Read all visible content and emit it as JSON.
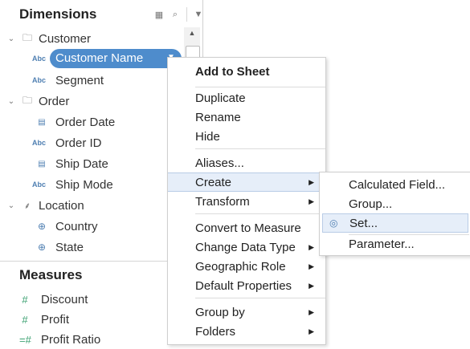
{
  "dimensions": {
    "title": "Dimensions",
    "header_icons": [
      "grid-icon",
      "search-icon",
      "dropdown-icon"
    ],
    "tree": [
      {
        "label": "Customer",
        "type": "folder"
      },
      {
        "label": "Customer Name",
        "type": "abc",
        "selected": true
      },
      {
        "label": "Segment",
        "type": "abc"
      },
      {
        "label": "Order",
        "type": "folder"
      },
      {
        "label": "Order Date",
        "type": "date"
      },
      {
        "label": "Order ID",
        "type": "abc"
      },
      {
        "label": "Ship Date",
        "type": "date"
      },
      {
        "label": "Ship Mode",
        "type": "abc"
      },
      {
        "label": "Location",
        "type": "hierarchy"
      },
      {
        "label": "Country",
        "type": "geo"
      },
      {
        "label": "State",
        "type": "geo"
      }
    ],
    "abc_badge": "Abc"
  },
  "measures": {
    "title": "Measures",
    "items": [
      {
        "label": "Discount"
      },
      {
        "label": "Profit"
      },
      {
        "label": "Profit Ratio"
      }
    ]
  },
  "context_menu": {
    "add_to_sheet": "Add to Sheet",
    "duplicate": "Duplicate",
    "rename": "Rename",
    "hide": "Hide",
    "aliases": "Aliases...",
    "create": "Create",
    "transform": "Transform",
    "convert_to_measure": "Convert to Measure",
    "change_data_type": "Change Data Type",
    "geographic_role": "Geographic Role",
    "default_properties": "Default Properties",
    "group_by": "Group by",
    "folders": "Folders"
  },
  "create_submenu": {
    "calculated_field": "Calculated Field...",
    "group": "Group...",
    "set": "Set...",
    "parameter": "Parameter..."
  },
  "colors": {
    "accent": "#4e8ccc",
    "highlight": "#e6eef9",
    "icon_blue": "#4f7fb2"
  }
}
